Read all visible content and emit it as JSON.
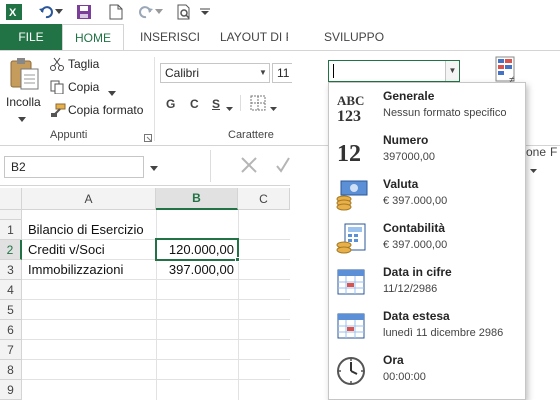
{
  "app": {
    "accent": "#217346"
  },
  "quick_access": {
    "icons": [
      "excel-logo-icon",
      "undo-icon",
      "save-icon",
      "new-file-icon",
      "redo-icon",
      "print-preview-icon"
    ]
  },
  "ribbon_tabs": {
    "file": "FILE",
    "home": "HOME",
    "insert": "INSERISCI",
    "layout": "LAYOUT DI P",
    "developer": "SVILUPPO"
  },
  "clipboard": {
    "paste": "Incolla",
    "cut": "Taglia",
    "copy": "Copia",
    "format_painter": "Copia formato",
    "group_label": "Appunti"
  },
  "font": {
    "name": "Calibri",
    "size": "11",
    "bold": "G",
    "italic": "C",
    "underline": "S",
    "group_label": "Carattere"
  },
  "right_ribbon": {
    "partial_label": "one",
    "partial_label2": "F"
  },
  "formula_bar": {
    "name_box": "B2"
  },
  "grid": {
    "columns": [
      "A",
      "B",
      "C"
    ],
    "rows": [
      "1",
      "2",
      "3",
      "4",
      "5",
      "6",
      "7",
      "8",
      "9"
    ],
    "cells": {
      "a1": "Bilancio di Esercizio",
      "a2": "Crediti v/Soci",
      "b2": "120.000,00",
      "a3": "Immobilizzazioni",
      "b3": "397.000,00"
    }
  },
  "number_format": {
    "current_value": "",
    "options": [
      {
        "label": "Generale",
        "sample": "Nessun formato specifico",
        "icon": "general-abc123-icon"
      },
      {
        "label": "Numero",
        "sample": "397000,00",
        "icon": "number-12-icon"
      },
      {
        "label": "Valuta",
        "sample": "€ 397.000,00",
        "icon": "currency-icon"
      },
      {
        "label": "Contabilità",
        "sample": "€ 397.000,00",
        "icon": "accounting-icon"
      },
      {
        "label": "Data in cifre",
        "sample": "11/12/2986",
        "icon": "short-date-calendar-icon"
      },
      {
        "label": "Data estesa",
        "sample": "lunedì 11 dicembre 2986",
        "icon": "long-date-calendar-icon"
      },
      {
        "label": "Ora",
        "sample": "00:00:00",
        "icon": "clock-icon"
      }
    ]
  }
}
